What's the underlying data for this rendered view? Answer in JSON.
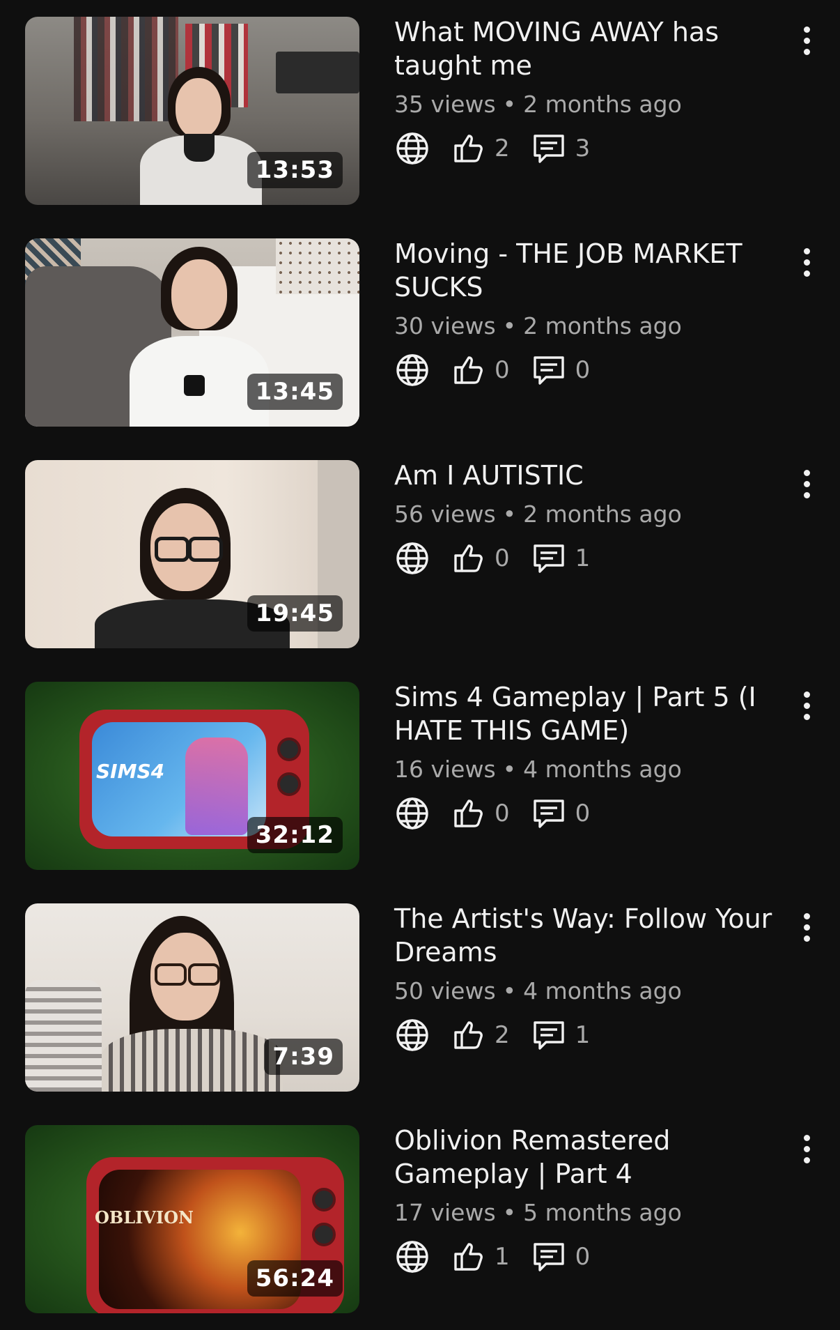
{
  "videos": [
    {
      "title": "What MOVING AWAY has taught me",
      "views": "35 views",
      "age": "2 months ago",
      "likes": "2",
      "comments": "3",
      "duration": "13:53"
    },
    {
      "title": "Moving - THE JOB MARKET SUCKS",
      "views": "30 views",
      "age": "2 months ago",
      "likes": "0",
      "comments": "0",
      "duration": "13:45"
    },
    {
      "title": "Am I AUTISTIC",
      "views": "56 views",
      "age": "2 months ago",
      "likes": "0",
      "comments": "1",
      "duration": "19:45"
    },
    {
      "title": "Sims 4 Gameplay | Part 5 (I HATE THIS GAME)",
      "views": "16 views",
      "age": "4 months ago",
      "likes": "0",
      "comments": "0",
      "duration": "32:12",
      "thumb_text": "SIMS4"
    },
    {
      "title": "The Artist's Way: Follow Your Dreams",
      "views": "50 views",
      "age": "4 months ago",
      "likes": "2",
      "comments": "1",
      "duration": "7:39"
    },
    {
      "title": "Oblivion Remastered Gameplay | Part 4",
      "views": "17 views",
      "age": "5 months ago",
      "likes": "1",
      "comments": "0",
      "duration": "56:24",
      "thumb_text": "OBLIVION"
    }
  ],
  "separator": "•",
  "icons": {
    "visibility": "globe-icon",
    "likes": "thumbs-up-icon",
    "comments": "comment-icon",
    "menu": "more-vertical-icon"
  },
  "colors": {
    "background": "#0f0f0f",
    "text_primary": "#f1f1f1",
    "text_secondary": "#aaaaaa"
  }
}
